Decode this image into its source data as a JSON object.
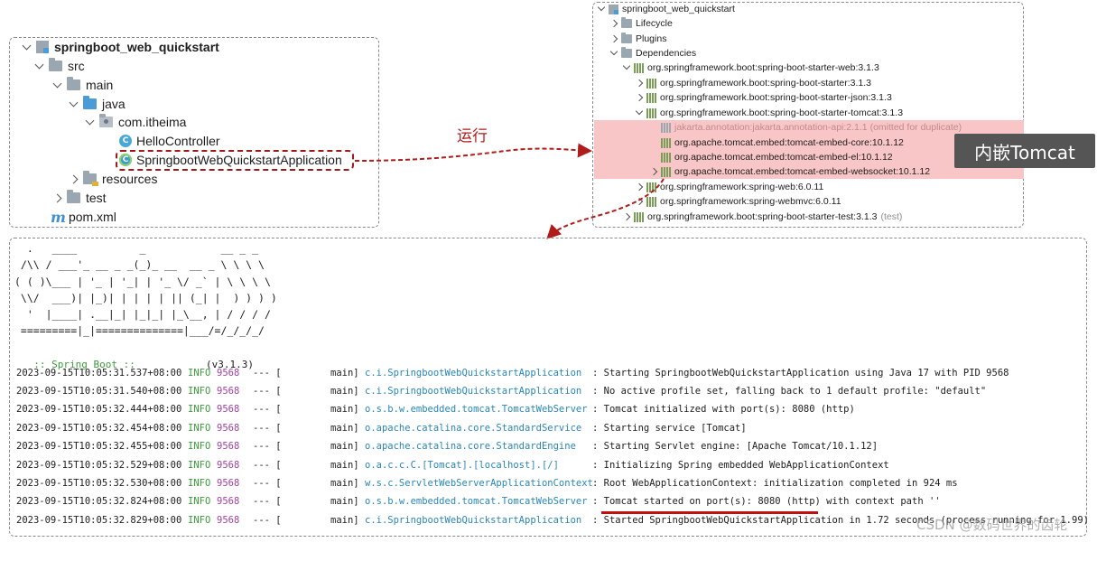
{
  "project_tree": {
    "root": "springboot_web_quickstart",
    "src": "src",
    "main": "main",
    "java": "java",
    "package": "com.itheima",
    "class_hello": "HelloController",
    "class_app": "SpringbootWebQuickstartApplication",
    "resources": "resources",
    "test": "test",
    "pom": "pom.xml",
    "maven_icon_glyph": "m",
    "class_icon_glyph": "C"
  },
  "annotation_run": "运行",
  "annotation_tomcat": "内嵌Tomcat",
  "maven_tree": {
    "root": "springboot_web_quickstart",
    "lifecycle": "Lifecycle",
    "plugins": "Plugins",
    "dependencies": "Dependencies",
    "starter_web": "org.springframework.boot:spring-boot-starter-web:3.1.3",
    "starter": "org.springframework.boot:spring-boot-starter:3.1.3",
    "starter_json": "org.springframework.boot:spring-boot-starter-json:3.1.3",
    "starter_tomcat": "org.springframework.boot:spring-boot-starter-tomcat:3.1.3",
    "jakarta": "jakarta.annotation:jakarta.annotation-api:2.1.1 (omitted for duplicate)",
    "tomcat_core": "org.apache.tomcat.embed:tomcat-embed-core:10.1.12",
    "tomcat_el": "org.apache.tomcat.embed:tomcat-embed-el:10.1.12",
    "tomcat_ws": "org.apache.tomcat.embed:tomcat-embed-websocket:10.1.12",
    "spring_web": "org.springframework:spring-web:6.0.11",
    "spring_webmvc": "org.springframework:spring-webmvc:6.0.11",
    "starter_test": "org.springframework.boot:spring-boot-starter-test:3.1.3",
    "starter_test_scope": "(test)"
  },
  "console": {
    "banner_lines": [
      "  .   ____          _            __ _ _",
      " /\\\\ / ___'_ __ _ _(_)_ __  __ _ \\ \\ \\ \\",
      "( ( )\\___ | '_ | '_| | '_ \\/ _` | \\ \\ \\ \\",
      " \\\\/  ___)| |_)| | | | | || (_| |  ) ) ) )",
      "  '  |____| .__|_| |_|_| |_\\__, | / / / /",
      " =========|_|==============|___/=/_/_/_/"
    ],
    "spring_boot_tag": ":: Spring Boot ::",
    "spring_boot_version": "(v3.1.3)",
    "log_lines": [
      {
        "ts": "2023-09-15T10:05:31.537+08:00",
        "level": "INFO",
        "pid": "9568",
        "sep": "--- [",
        "thread": "main]",
        "logger": "c.i.SpringbootWebQuickstartApplication",
        "msg": ": Starting SpringbootWebQuickstartApplication using Java 17 with PID 9568"
      },
      {
        "ts": "2023-09-15T10:05:31.540+08:00",
        "level": "INFO",
        "pid": "9568",
        "sep": "--- [",
        "thread": "main]",
        "logger": "c.i.SpringbootWebQuickstartApplication",
        "msg": ": No active profile set, falling back to 1 default profile: \"default\""
      },
      {
        "ts": "2023-09-15T10:05:32.444+08:00",
        "level": "INFO",
        "pid": "9568",
        "sep": "--- [",
        "thread": "main]",
        "logger": "o.s.b.w.embedded.tomcat.TomcatWebServer",
        "msg": ": Tomcat initialized with port(s): 8080 (http)"
      },
      {
        "ts": "2023-09-15T10:05:32.454+08:00",
        "level": "INFO",
        "pid": "9568",
        "sep": "--- [",
        "thread": "main]",
        "logger": "o.apache.catalina.core.StandardService",
        "msg": ": Starting service [Tomcat]"
      },
      {
        "ts": "2023-09-15T10:05:32.455+08:00",
        "level": "INFO",
        "pid": "9568",
        "sep": "--- [",
        "thread": "main]",
        "logger": "o.apache.catalina.core.StandardEngine",
        "msg": ": Starting Servlet engine: [Apache Tomcat/10.1.12]"
      },
      {
        "ts": "2023-09-15T10:05:32.529+08:00",
        "level": "INFO",
        "pid": "9568",
        "sep": "--- [",
        "thread": "main]",
        "logger": "o.a.c.c.C.[Tomcat].[localhost].[/]",
        "msg": ": Initializing Spring embedded WebApplicationContext"
      },
      {
        "ts": "2023-09-15T10:05:32.530+08:00",
        "level": "INFO",
        "pid": "9568",
        "sep": "--- [",
        "thread": "main]",
        "logger": "w.s.c.ServletWebServerApplicationContext",
        "msg": ": Root WebApplicationContext: initialization completed in 924 ms"
      },
      {
        "ts": "2023-09-15T10:05:32.824+08:00",
        "level": "INFO",
        "pid": "9568",
        "sep": "--- [",
        "thread": "main]",
        "logger": "o.s.b.w.embedded.tomcat.TomcatWebServer",
        "msg": ": Tomcat started on port(s): 8080 (http) with context path ''"
      },
      {
        "ts": "2023-09-15T10:05:32.829+08:00",
        "level": "INFO",
        "pid": "9568",
        "sep": "--- [",
        "thread": "main]",
        "logger": "c.i.SpringbootWebQuickstartApplication",
        "msg": ": Started SpringbootWebQuickstartApplication in 1.72 seconds (process running for 1.99)"
      }
    ]
  },
  "watermark": "CSDN @数码世界的齿轮",
  "colors": {
    "annotation_red": "#b01c1c",
    "highlight_pink": "#f8c6c6",
    "log_green": "#3a9b3a",
    "log_purple": "#a242a2",
    "log_blue": "#2a86b8"
  }
}
